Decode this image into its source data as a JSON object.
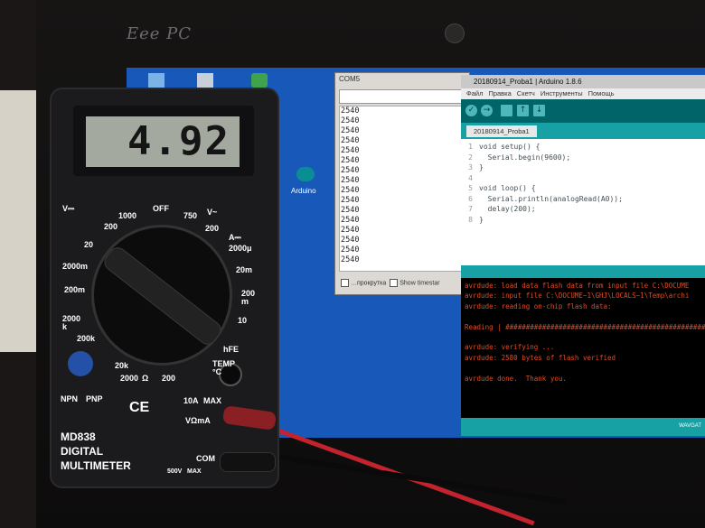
{
  "laptop": {
    "brand": "Eee PC"
  },
  "desktop": {
    "arduino_shortcut_label": "Arduino"
  },
  "serial_monitor": {
    "title": "COM5",
    "lines": [
      "2540",
      "2540",
      "2540",
      "2540",
      "2540",
      "2540",
      "2540",
      "2540",
      "2540",
      "2540",
      "2540",
      "2540",
      "2540",
      "2540",
      "2540",
      "2540"
    ],
    "autoscroll_label": "…прокрутка",
    "timestamp_label": "Show timestar"
  },
  "ide": {
    "title": "20180914_Proba1 | Arduino 1.8.6",
    "menu": [
      "Файл",
      "Правка",
      "Скетч",
      "Инструменты",
      "Помощь"
    ],
    "tab": "20180914_Proba1",
    "code": [
      {
        "n": "1",
        "text": "void setup() {"
      },
      {
        "n": "2",
        "text": "  Serial.begin(9600);"
      },
      {
        "n": "3",
        "text": "}"
      },
      {
        "n": "4",
        "text": ""
      },
      {
        "n": "5",
        "text": "void loop() {"
      },
      {
        "n": "6",
        "text": "  Serial.println(analogRead(A0));"
      },
      {
        "n": "7",
        "text": "  delay(200);"
      },
      {
        "n": "8",
        "text": "}"
      }
    ],
    "console": [
      "avrdude: load data flash data from input file C:\\DOCUME",
      "avrdude: input file C:\\DOCUME~1\\GHJ\\LOCALS~1\\Temp\\archi",
      "avrdude: reading on-chip flash data:",
      "",
      "Reading | ##################################################",
      "",
      "avrdude: verifying ...",
      "avrdude: 2580 bytes of flash verified",
      "",
      "avrdude done.  Thank you."
    ],
    "board_status": "WAVGAT"
  },
  "multimeter": {
    "reading": "4.92",
    "model": "MD838",
    "name_line1": "DIGITAL",
    "name_line2": "MULTIMETER",
    "dial_labels": [
      "V⎓",
      "1000",
      "200",
      "20",
      "2000m",
      "200m",
      "2000\nk",
      "200k",
      "20k",
      "2000",
      "Ω",
      "200",
      "OFF",
      "750",
      "V~",
      "200",
      "A⎓",
      "2000μ",
      "20m",
      "200\nm",
      "10",
      "hFE",
      "TEMP\n°C"
    ],
    "jack_labels": [
      "10A",
      "MAX",
      "COM",
      "VΩmA",
      "500V",
      "MAX"
    ],
    "hfe_labels": [
      "NPN",
      "PNP"
    ]
  },
  "colors": {
    "desktop": "#1758b8",
    "ide_teal": "#006468",
    "console_text": "#e34c22",
    "lcd": "#a4a9a0"
  }
}
